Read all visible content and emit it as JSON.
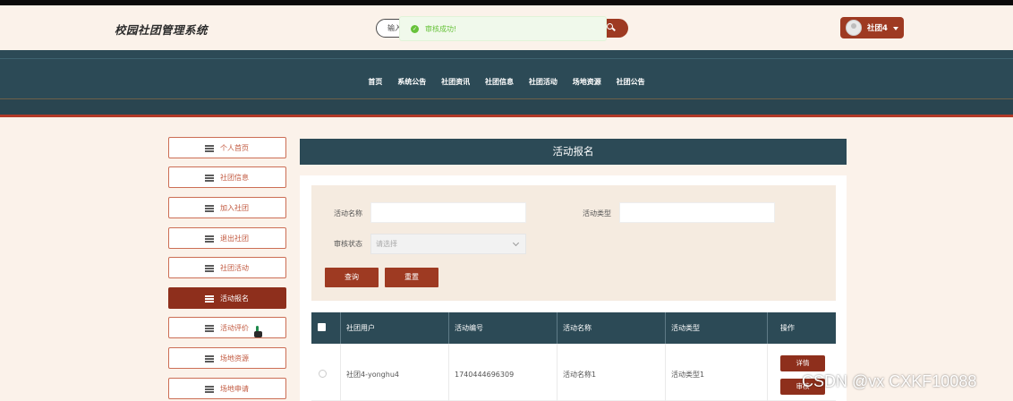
{
  "header": {
    "site_title": "校园社团管理系统",
    "search_placeholder": "输入",
    "toast": "审核成功!",
    "user_name": "社团4"
  },
  "nav": [
    "首页",
    "系统公告",
    "社团资讯",
    "社团信息",
    "社团活动",
    "场地资源",
    "社团公告"
  ],
  "sidebar": [
    {
      "label": "个人首页",
      "active": false
    },
    {
      "label": "社团信息",
      "active": false
    },
    {
      "label": "加入社团",
      "active": false
    },
    {
      "label": "退出社团",
      "active": false
    },
    {
      "label": "社团活动",
      "active": false
    },
    {
      "label": "活动报名",
      "active": true
    },
    {
      "label": "活动评价",
      "active": false
    },
    {
      "label": "场地资源",
      "active": false
    },
    {
      "label": "场地申请",
      "active": false
    }
  ],
  "panel": {
    "title": "活动报名",
    "filters": {
      "name_label": "活动名称",
      "type_label": "活动类型",
      "status_label": "审核状态",
      "status_placeholder": "请选择"
    },
    "query_btn": "查询",
    "reset_btn": "重置"
  },
  "table": {
    "headers": [
      "社团用户",
      "活动编号",
      "活动名称",
      "活动类型",
      "操作"
    ],
    "rows": [
      {
        "user": "社团4-yonghu4",
        "code": "1740444696309",
        "name": "活动名称1",
        "type": "活动类型1",
        "actions": [
          "详情",
          "审核"
        ]
      }
    ]
  },
  "watermark": "CSDN @vx  CXKF10088",
  "colors": {
    "primary": "#9e3a22",
    "nav": "#2c4a56",
    "bg": "#fbf2ea",
    "success": "#67c23a"
  }
}
